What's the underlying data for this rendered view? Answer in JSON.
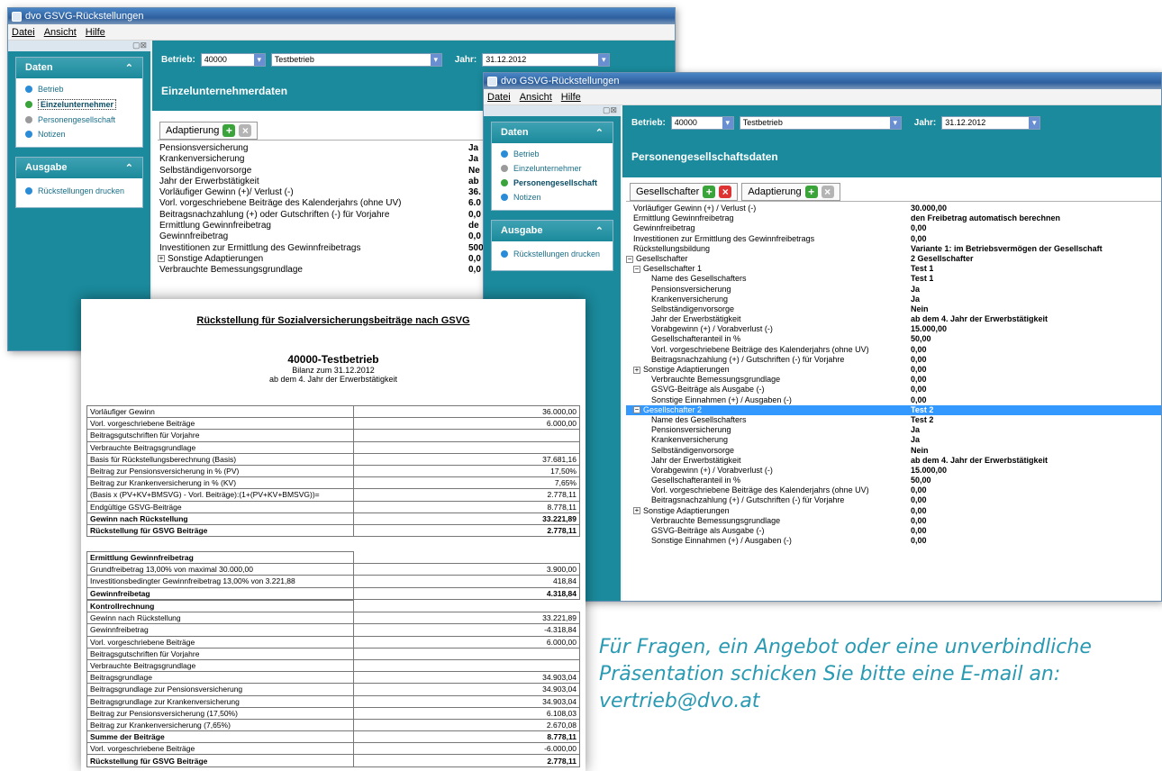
{
  "win1": {
    "title": "dvo GSVG-Rückstellungen",
    "menu": [
      "Datei",
      "Ansicht",
      "Hilfe"
    ],
    "sidebar": {
      "daten_title": "Daten",
      "daten_items": [
        {
          "label": "Betrieb",
          "icon": "blue"
        },
        {
          "label": "Einzelunternehmer",
          "icon": "green"
        },
        {
          "label": "Personengesellschaft",
          "icon": "gray"
        },
        {
          "label": "Notizen",
          "icon": "blue"
        }
      ],
      "ausgabe_title": "Ausgabe",
      "ausgabe_items": [
        {
          "label": "Rückstellungen drucken"
        }
      ]
    },
    "betrieb_label": "Betrieb:",
    "betrieb_nr": "40000",
    "betrieb_name": "Testbetrieb",
    "jahr_label": "Jahr:",
    "jahr_value": "31.12.2012",
    "section_title": "Einzelunternehmerdaten",
    "adaptierung": "Adaptierung",
    "rows": [
      [
        "Pensionsversicherung",
        "Ja"
      ],
      [
        "Krankenversicherung",
        "Ja"
      ],
      [
        "Selbständigenvorsorge",
        "Ne"
      ],
      [
        "Jahr der Erwerbstätigkeit",
        "ab"
      ],
      [
        "Vorläufiger Gewinn (+)/ Verlust (-)",
        "36."
      ],
      [
        "Vorl. vorgeschriebene Beiträge des Kalenderjahrs (ohne UV)",
        "6.0"
      ],
      [
        "Beitragsnachzahlung (+) oder Gutschriften (-) für Vorjahre",
        "0,0"
      ],
      [
        "Ermittlung Gewinnfreibetrag",
        "de"
      ],
      [
        "Gewinnfreibetrag",
        "0,0"
      ],
      [
        "Investitionen zur Ermittlung des Gewinnfreibetrags",
        "500"
      ],
      [
        "Sonstige Adaptierungen",
        "0,0"
      ],
      [
        "Verbrauchte Bemessungsgrundlage",
        "0,0"
      ]
    ]
  },
  "win2": {
    "title": "dvo GSVG-Rückstellungen",
    "menu": [
      "Datei",
      "Ansicht",
      "Hilfe"
    ],
    "sidebar": {
      "daten_title": "Daten",
      "daten_items": [
        {
          "label": "Betrieb",
          "icon": "blue"
        },
        {
          "label": "Einzelunternehmer",
          "icon": "gray"
        },
        {
          "label": "Personengesellschaft",
          "icon": "green"
        },
        {
          "label": "Notizen",
          "icon": "blue"
        }
      ],
      "ausgabe_title": "Ausgabe",
      "ausgabe_items": [
        {
          "label": "Rückstellungen drucken"
        }
      ]
    },
    "betrieb_label": "Betrieb:",
    "betrieb_nr": "40000",
    "betrieb_name": "Testbetrieb",
    "jahr_label": "Jahr:",
    "jahr_value": "31.12.2012",
    "section_title": "Personengesellschaftsdaten",
    "gesellschafter": "Gesellschafter",
    "adaptierung": "Adaptierung",
    "rows": [
      {
        "k": "Vorläufiger Gewinn (+) / Verlust (-)",
        "v": "30.000,00",
        "i": 0
      },
      {
        "k": "Ermittlung Gewinnfreibetrag",
        "v": "den Freibetrag automatisch berechnen",
        "i": 0
      },
      {
        "k": "Gewinnfreibetrag",
        "v": "0,00",
        "i": 0
      },
      {
        "k": "Investitionen zur Ermittlung des Gewinnfreibetrags",
        "v": "0,00",
        "i": 0
      },
      {
        "k": "Rückstellungsbildung",
        "v": "Variante 1: im Betriebsvermögen der Gesellschaft",
        "i": 0
      },
      {
        "k": "Gesellschafter",
        "v": "2 Gesellschafter",
        "i": 0,
        "pm": "⊟"
      },
      {
        "k": "Gesellschafter 1",
        "v": "Test 1",
        "i": 1,
        "pm": "⊟"
      },
      {
        "k": "Name des Gesellschafters",
        "v": "Test 1",
        "i": 2
      },
      {
        "k": "Pensionsversicherung",
        "v": "Ja",
        "i": 2
      },
      {
        "k": "Krankenversicherung",
        "v": "Ja",
        "i": 2
      },
      {
        "k": "Selbständigenvorsorge",
        "v": "Nein",
        "i": 2
      },
      {
        "k": "Jahr der Erwerbstätigkeit",
        "v": "ab dem 4. Jahr der Erwerbstätigkeit",
        "i": 2
      },
      {
        "k": "Vorabgewinn (+) / Vorabverlust (-)",
        "v": "15.000,00",
        "i": 2
      },
      {
        "k": "Gesellschafteranteil in %",
        "v": "50,00",
        "i": 2
      },
      {
        "k": "Vorl. vorgeschriebene Beiträge des Kalenderjahrs (ohne UV)",
        "v": "0,00",
        "i": 2
      },
      {
        "k": "Beitragsnachzahlung (+) / Gutschriften (-) für Vorjahre",
        "v": "0,00",
        "i": 2
      },
      {
        "k": "Sonstige Adaptierungen",
        "v": "0,00",
        "i": 1,
        "pm": "⊞"
      },
      {
        "k": "Verbrauchte Bemessungsgrundlage",
        "v": "0,00",
        "i": 2
      },
      {
        "k": "GSVG-Beiträge als Ausgabe (-)",
        "v": "0,00",
        "i": 2
      },
      {
        "k": "Sonstige Einnahmen (+) / Ausgaben (-)",
        "v": "0,00",
        "i": 2
      },
      {
        "k": "Gesellschafter 2",
        "v": "Test 2",
        "i": 1,
        "pm": "⊟",
        "sel": true
      },
      {
        "k": "Name des Gesellschafters",
        "v": "Test 2",
        "i": 2
      },
      {
        "k": "Pensionsversicherung",
        "v": "Ja",
        "i": 2
      },
      {
        "k": "Krankenversicherung",
        "v": "Ja",
        "i": 2
      },
      {
        "k": "Selbständigenvorsorge",
        "v": "Nein",
        "i": 2
      },
      {
        "k": "Jahr der Erwerbstätigkeit",
        "v": "ab dem 4. Jahr der Erwerbstätigkeit",
        "i": 2
      },
      {
        "k": "Vorabgewinn (+) / Vorabverlust (-)",
        "v": "15.000,00",
        "i": 2
      },
      {
        "k": "Gesellschafteranteil in %",
        "v": "50,00",
        "i": 2
      },
      {
        "k": "Vorl. vorgeschriebene Beiträge des Kalenderjahrs (ohne UV)",
        "v": "0,00",
        "i": 2
      },
      {
        "k": "Beitragsnachzahlung (+) / Gutschriften (-) für Vorjahre",
        "v": "0,00",
        "i": 2
      },
      {
        "k": "Sonstige Adaptierungen",
        "v": "0,00",
        "i": 1,
        "pm": "⊞"
      },
      {
        "k": "Verbrauchte Bemessungsgrundlage",
        "v": "0,00",
        "i": 2
      },
      {
        "k": "GSVG-Beiträge als Ausgabe (-)",
        "v": "0,00",
        "i": 2
      },
      {
        "k": "Sonstige Einnahmen (+) / Ausgaben (-)",
        "v": "0,00",
        "i": 2
      }
    ]
  },
  "report": {
    "title": "Rückstellung für Sozialversicherungsbeiträge nach GSVG",
    "company": "40000-Testbetrieb",
    "bilanz": "Bilanz zum 31.12.2012",
    "jahr": "ab dem 4. Jahr der Erwerbstätigkeit",
    "table1": [
      [
        "Vorläufiger Gewinn",
        "36.000,00",
        0
      ],
      [
        "Vorl. vorgeschriebene Beiträge",
        "6.000,00",
        0
      ],
      [
        "Beitragsgutschriften für Vorjahre",
        "",
        0
      ],
      [
        "Verbrauchte Beitragsgrundlage",
        "",
        0
      ],
      [
        "Basis für Rückstellungsberechnung (Basis)",
        "37.681,16",
        0
      ],
      [
        "Beitrag zur Pensionsversicherung in % (PV)",
        "17,50%",
        0
      ],
      [
        "Beitrag zur Krankenversicherung in % (KV)",
        "7,65%",
        0
      ],
      [
        "(Basis x (PV+KV+BMSVG) - Vorl. Beiträge):(1+(PV+KV+BMSVG))=",
        "2.778,11",
        0
      ],
      [
        "Endgültige GSVG-Beiträge",
        "8.778,11",
        0
      ],
      [
        "Gewinn nach Rückstellung",
        "33.221,89",
        1
      ],
      [
        "Rückstellung für GSVG Beiträge",
        "2.778,11",
        1
      ]
    ],
    "table2_title": "Ermittlung Gewinnfreibetrag",
    "table2": [
      [
        "Grundfreibetrag 13,00% von maximal 30.000,00",
        "3.900,00",
        0
      ],
      [
        "Investitionsbedingter Gewinnfreibetrag 13,00% von 3.221,88",
        "418,84",
        0
      ],
      [
        "Gewinnfreibetag",
        "4.318,84",
        1
      ]
    ],
    "table3_title": "Kontrollrechnung",
    "table3": [
      [
        "Gewinn nach Rückstellung",
        "33.221,89",
        0
      ],
      [
        "Gewinnfreibetrag",
        "-4.318,84",
        0
      ],
      [
        "Vorl. vorgeschriebene Beiträge",
        "6.000,00",
        0
      ],
      [
        "Beitragsgutschriften für Vorjahre",
        "",
        0
      ],
      [
        "Verbrauchte Beitragsgrundlage",
        "",
        0
      ],
      [
        "Beitragsgrundlage",
        "34.903,04",
        0
      ],
      [
        "Beitragsgrundlage zur Pensionsversicherung",
        "34.903,04",
        0
      ],
      [
        "Beitragsgrundlage zur Krankenversicherung",
        "34.903,04",
        0
      ],
      [
        "Beitrag zur Pensionsversicherung (17,50%)",
        "6.108,03",
        0
      ],
      [
        "Beitrag zur Krankenversicherung (7,65%)",
        "2.670,08",
        0
      ],
      [
        "Summe der Beiträge",
        "8.778,11",
        1
      ],
      [
        "Vorl. vorgeschriebene Beiträge",
        "-6.000,00",
        0
      ],
      [
        "Rückstellung für GSVG Beiträge",
        "2.778,11",
        1
      ]
    ]
  },
  "contact": "Für Fragen, ein Angebot oder eine unverbindliche Präsentation schicken Sie bitte eine E-mail an: vertrieb@dvo.at",
  "colors": {
    "teal": "#1a8a9c",
    "contact": "#2a9ab3",
    "selection": "#3399ff"
  }
}
